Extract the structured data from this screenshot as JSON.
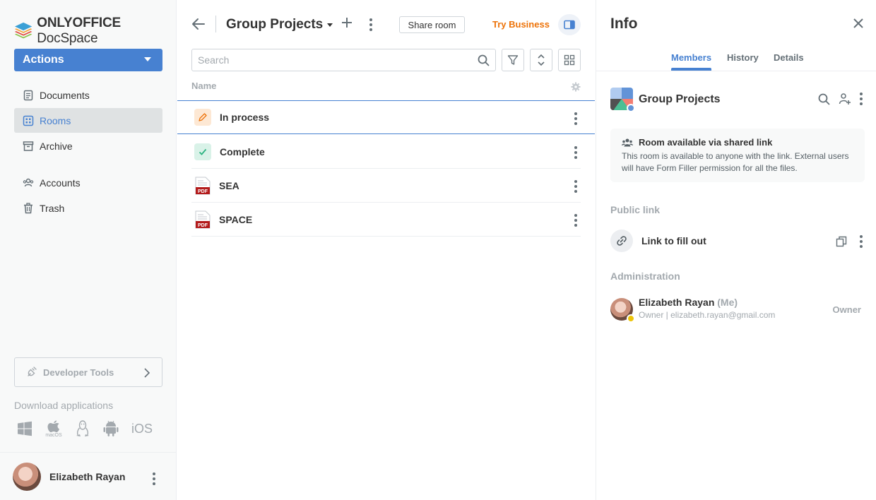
{
  "app": {
    "logo_brand": "ONLYOFFICE",
    "logo_product": " DocSpace",
    "actions_label": "Actions"
  },
  "sidebar": {
    "items": [
      {
        "label": "Documents",
        "icon": "document-icon"
      },
      {
        "label": "Rooms",
        "icon": "rooms-icon",
        "active": true
      },
      {
        "label": "Archive",
        "icon": "archive-icon"
      },
      {
        "label": "Accounts",
        "icon": "accounts-icon"
      },
      {
        "label": "Trash",
        "icon": "trash-icon"
      }
    ],
    "developer_tools": "Developer Tools",
    "download_label": "Download applications",
    "apps": [
      "windows",
      "macOS",
      "linux",
      "android",
      "iOS"
    ],
    "macos_label": "macOS",
    "ios_label": "iOS",
    "profile_name": "Elizabeth Rayan"
  },
  "header": {
    "room_title": "Group Projects",
    "share_room": "Share room",
    "try_business": "Try Business"
  },
  "search": {
    "placeholder": "Search"
  },
  "list": {
    "column_name": "Name",
    "rows": [
      {
        "label": "In process",
        "type": "folder-in-process",
        "selected": true
      },
      {
        "label": "Complete",
        "type": "folder-complete"
      },
      {
        "label": "SEA",
        "type": "pdf"
      },
      {
        "label": "SPACE",
        "type": "pdf"
      }
    ],
    "pdf_badge": "PDF"
  },
  "info": {
    "title": "Info",
    "tabs": [
      "Members",
      "History",
      "Details"
    ],
    "active_tab": "Members",
    "room_name": "Group Projects",
    "notice_title": "Room available via shared link",
    "notice_text": "This room is available to anyone with the link. External users will have Form Filler permission for all the files.",
    "public_link_label": "Public link",
    "link_name": "Link to fill out",
    "administration_label": "Administration",
    "member_name": "Elizabeth Rayan",
    "member_me": "(Me)",
    "member_sub": "Owner | elizabeth.rayan@gmail.com",
    "member_role": "Owner"
  },
  "colors": {
    "accent": "#4781d1",
    "business": "#ed7309",
    "muted": "#a3a9ae",
    "in_process_bg": "#fde8d4",
    "complete_bg": "#d9f2e8",
    "pdf_red": "#c21c1c"
  }
}
